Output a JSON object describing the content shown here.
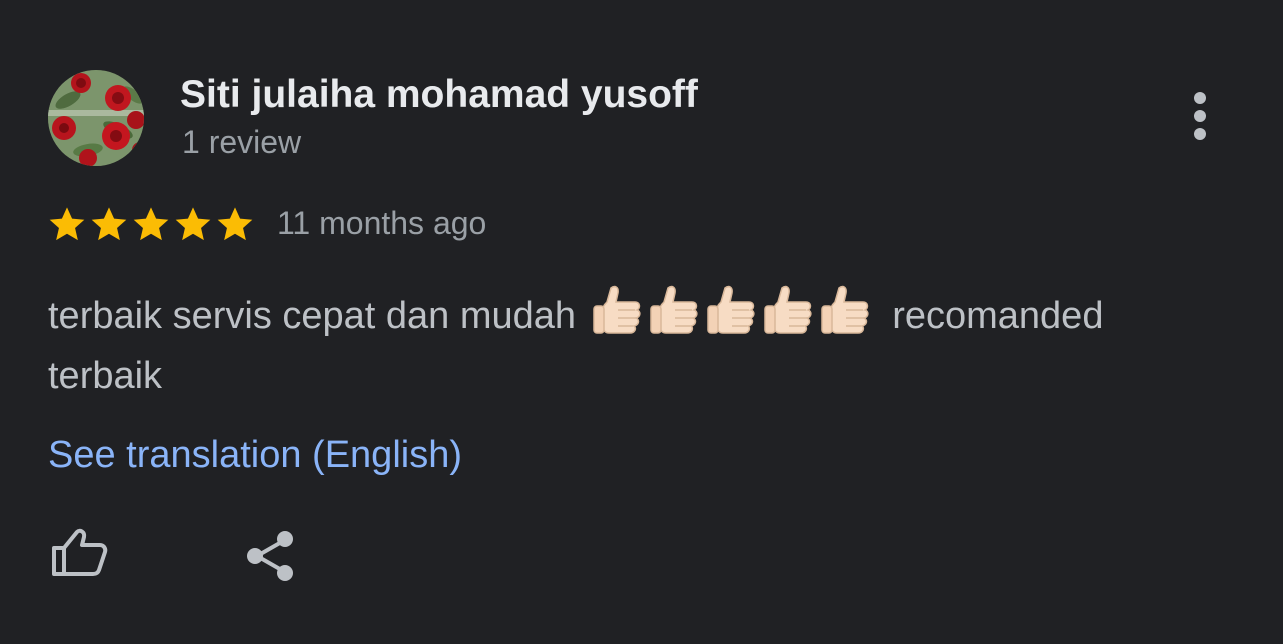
{
  "review": {
    "author_name": "Siti julaiha mohamad yusoff",
    "author_review_count": "1 review",
    "rating": 5,
    "rating_max": 5,
    "time_ago": "11 months ago",
    "text_before_emoji": "terbaik servis cepat dan mudah",
    "emojis": [
      "thumbs-up-emoji",
      "thumbs-up-emoji",
      "thumbs-up-emoji",
      "thumbs-up-emoji",
      "thumbs-up-emoji"
    ],
    "text_after_emoji": "recomanded terbaik",
    "see_translation_label": "See translation (English)"
  },
  "icons": {
    "avatar": "rose-avatar",
    "more": "more-vert-icon",
    "like": "thumbs-up-outline-icon",
    "share": "share-icon"
  },
  "colors": {
    "background": "#202124",
    "star": "#fbbc04",
    "link": "#8ab4f8",
    "primary_text": "#e8eaed",
    "secondary_text": "#9aa0a6"
  }
}
